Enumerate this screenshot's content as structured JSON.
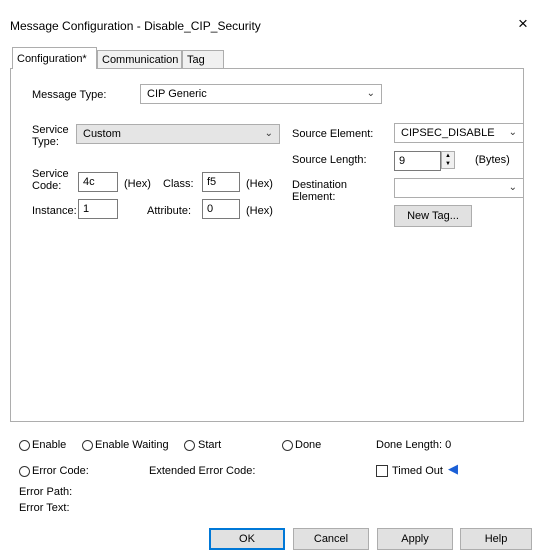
{
  "window": {
    "title": "Message Configuration - Disable_CIP_Security",
    "close": "×"
  },
  "tabs": [
    {
      "label": "Configuration*"
    },
    {
      "label": "Communication"
    },
    {
      "label": "Tag"
    }
  ],
  "config": {
    "message_type_label": "Message Type:",
    "message_type_value": "CIP Generic",
    "service_type_label": "Service\nType:",
    "service_type_value": "Custom",
    "service_code_label": "Service\nCode:",
    "service_code_value": "4c",
    "hex1": "(Hex)",
    "class_label": "Class:",
    "class_value": "f5",
    "hex2": "(Hex)",
    "instance_label": "Instance:",
    "instance_value": "1",
    "attribute_label": "Attribute:",
    "attribute_value": "0",
    "hex3": "(Hex)",
    "source_element_label": "Source Element:",
    "source_element_value": "CIPSEC_DISABLE",
    "source_length_label": "Source Length:",
    "source_length_value": "9",
    "bytes": "(Bytes)",
    "destination_label": "Destination\nElement:",
    "destination_value": "",
    "new_tag": "New Tag..."
  },
  "status": {
    "enable": "Enable",
    "enable_waiting": "Enable Waiting",
    "start": "Start",
    "done": "Done",
    "done_length": "Done Length: 0",
    "error_code": "Error Code:",
    "extended_error_code": "Extended Error Code:",
    "timed_out": "Timed Out",
    "error_path": "Error Path:",
    "error_text": "Error Text:"
  },
  "buttons": {
    "ok": "OK",
    "cancel": "Cancel",
    "apply": "Apply",
    "help": "Help"
  },
  "colors": {
    "accent": "#0078d7",
    "arrow": "#1a5fd6"
  }
}
